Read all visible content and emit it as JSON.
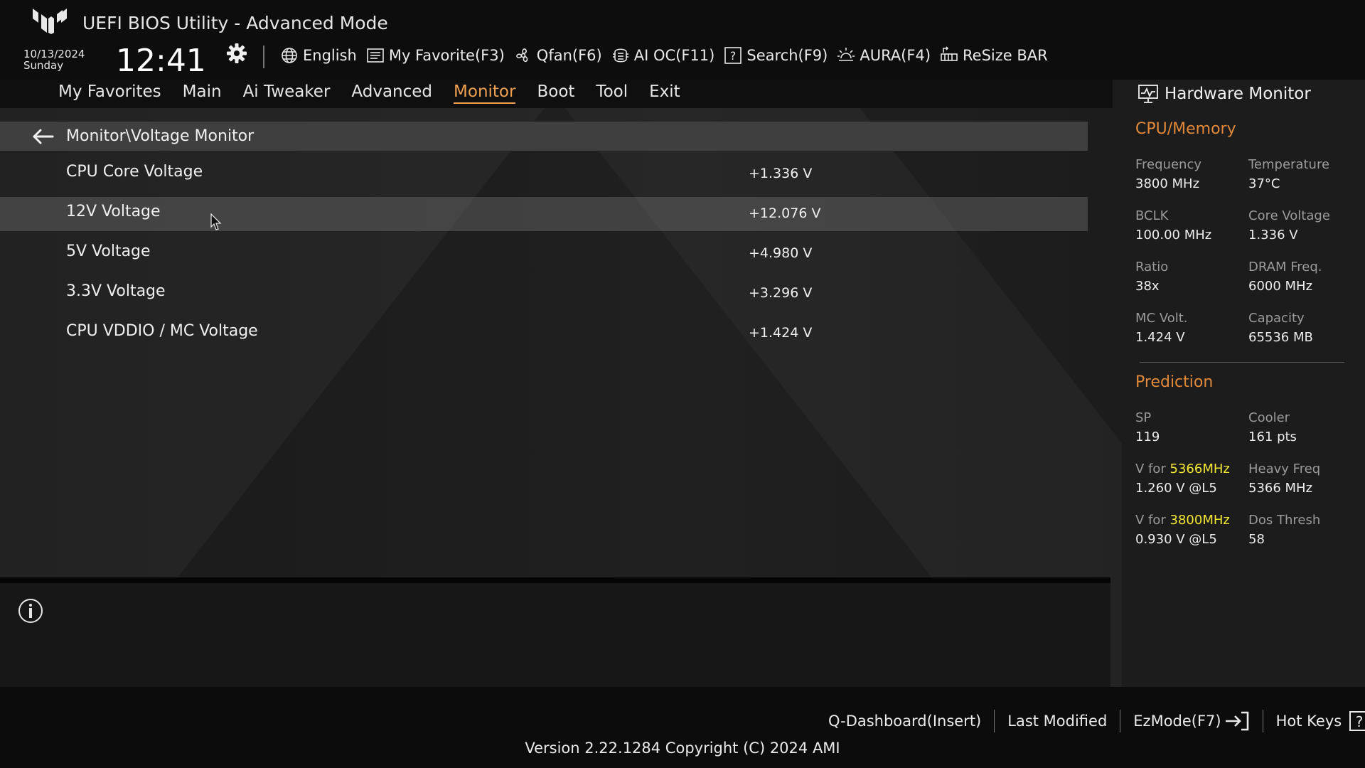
{
  "app": {
    "title": "UEFI BIOS Utility - Advanced Mode",
    "date": "10/13/2024",
    "day": "Sunday",
    "time": "12:41"
  },
  "toolbar": {
    "items": [
      {
        "label": "English",
        "icon": "globe-icon"
      },
      {
        "label": "My Favorite(F3)",
        "icon": "favorite-list-icon"
      },
      {
        "label": "Qfan(F6)",
        "icon": "fan-icon"
      },
      {
        "label": "AI OC(F11)",
        "icon": "ai-chip-icon"
      },
      {
        "label": "Search(F9)",
        "icon": "search-help-icon"
      },
      {
        "label": "AURA(F4)",
        "icon": "aura-light-icon"
      },
      {
        "label": "ReSize BAR",
        "icon": "resize-bar-icon"
      }
    ]
  },
  "nav": {
    "tabs": [
      "My Favorites",
      "Main",
      "Ai Tweaker",
      "Advanced",
      "Monitor",
      "Boot",
      "Tool",
      "Exit"
    ],
    "active": "Monitor"
  },
  "breadcrumb": {
    "path": "Monitor\\Voltage Monitor"
  },
  "rows": [
    {
      "label": "CPU Core Voltage",
      "value": "+1.336 V"
    },
    {
      "label": "12V Voltage",
      "value": "+12.076 V"
    },
    {
      "label": "5V Voltage",
      "value": "+4.980 V"
    },
    {
      "label": "3.3V Voltage",
      "value": "+3.296 V"
    },
    {
      "label": "CPU VDDIO / MC Voltage",
      "value": "+1.424 V"
    }
  ],
  "hardware_monitor": {
    "title": "Hardware Monitor",
    "cpu_memory": {
      "heading": "CPU/Memory",
      "items": [
        {
          "label": "Frequency",
          "value": "3800 MHz"
        },
        {
          "label": "Temperature",
          "value": "37°C"
        },
        {
          "label": "BCLK",
          "value": "100.00 MHz"
        },
        {
          "label": "Core Voltage",
          "value": "1.336 V"
        },
        {
          "label": "Ratio",
          "value": "38x"
        },
        {
          "label": "DRAM Freq.",
          "value": "6000 MHz"
        },
        {
          "label": "MC Volt.",
          "value": "1.424 V"
        },
        {
          "label": "Capacity",
          "value": "65536 MB"
        }
      ]
    },
    "prediction": {
      "heading": "Prediction",
      "sp": {
        "label": "SP",
        "value": "119"
      },
      "cooler": {
        "label": "Cooler",
        "value": "161 pts"
      },
      "v1": {
        "prefix": "V for ",
        "freq": "5366MHz",
        "value": "1.260 V @L5"
      },
      "heavy": {
        "label": "Heavy Freq",
        "value": "5366 MHz"
      },
      "v2": {
        "prefix": "V for ",
        "freq": "3800MHz",
        "value": "0.930 V @L5"
      },
      "dos": {
        "label": "Dos Thresh",
        "value": "58"
      }
    }
  },
  "footer": {
    "items": [
      "Q-Dashboard(Insert)",
      "Last Modified",
      "EzMode(F7)",
      "Hot Keys"
    ],
    "version": "Version 2.22.1284 Copyright (C) 2024 AMI"
  },
  "colors": {
    "accent": "#f0a050",
    "section_heading": "#e0883a",
    "highlight": "#f2e533"
  }
}
